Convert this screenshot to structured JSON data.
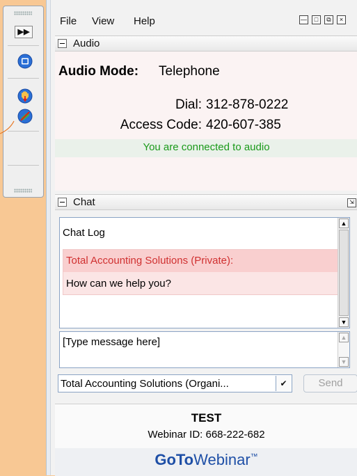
{
  "menubar": {
    "items": [
      "File",
      "View",
      "Help"
    ]
  },
  "audio": {
    "header": "Audio",
    "mode_label": "Audio Mode:",
    "mode_value": "Telephone",
    "dial_label": "Dial:",
    "dial_number": "312-878-0222",
    "access_label": "Access Code:",
    "access_code": "420-607-385",
    "status": "You are connected to audio"
  },
  "chat": {
    "header": "Chat",
    "log_title": "Chat Log",
    "message_sender": "Total Accounting Solutions (Private):",
    "message_text": "How can we help you?",
    "compose_placeholder": "[Type message here]",
    "recipient": "Total Accounting Solutions (Organi...",
    "send_label": "Send"
  },
  "footer": {
    "webinar_name": "TEST",
    "webinar_id": "Webinar ID: 668-222-682",
    "logo_bold": "GoTo",
    "logo_rest": "Webinar",
    "logo_tm": "™"
  },
  "colors": {
    "accent": "#1e4fa6",
    "status": "#1a9a1a",
    "private": "#d03030",
    "background": "#f8c894"
  },
  "icons": [
    "expand-arrows-icon",
    "screen-icon",
    "raise-hand-icon",
    "mute-mic-icon"
  ]
}
